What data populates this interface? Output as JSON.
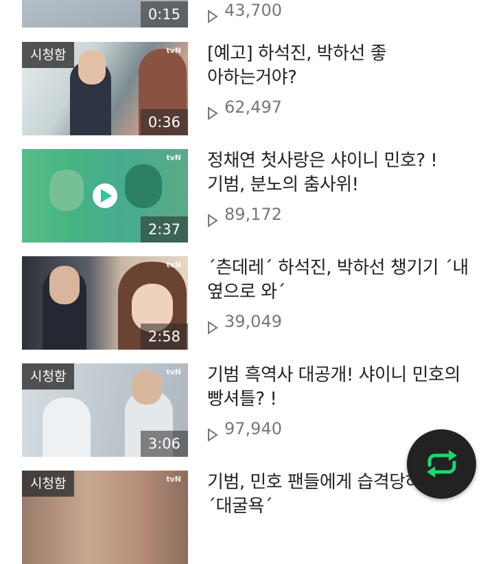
{
  "items": [
    {
      "title": "",
      "views": "43,700",
      "duration": "0:15",
      "watched": ""
    },
    {
      "title": "[예고] 하석진, 박하선 좋아하는거야?",
      "views": "62,497",
      "duration": "0:36",
      "watched": "시청함"
    },
    {
      "title": "정채연 첫사랑은 샤이니 민호? ! 기범, 분노의 춤사위!",
      "views": "89,172",
      "duration": "2:37",
      "watched": ""
    },
    {
      "title": "´츤데레´ 하석진, 박하선 챙기기 ´내 옆으로 와´",
      "views": "39,049",
      "duration": "2:58",
      "watched": ""
    },
    {
      "title": "기범 흑역사 대공개! 샤이니 민호의 빵셔틀? !",
      "views": "97,940",
      "duration": "3:06",
      "watched": "시청함"
    },
    {
      "title": "기범, 민호 팬들에게 습격당하다! ´대굴욕´",
      "views": "",
      "duration": "",
      "watched": "시청함"
    }
  ],
  "channel_logo": "tvN",
  "colors": {
    "play_accent": "#2ec79a",
    "fab_icon": "#19d96b"
  },
  "icons": {
    "views": "play-triangle-icon",
    "fab": "repeat-icon",
    "thumb_play": "play-circle-icon"
  }
}
